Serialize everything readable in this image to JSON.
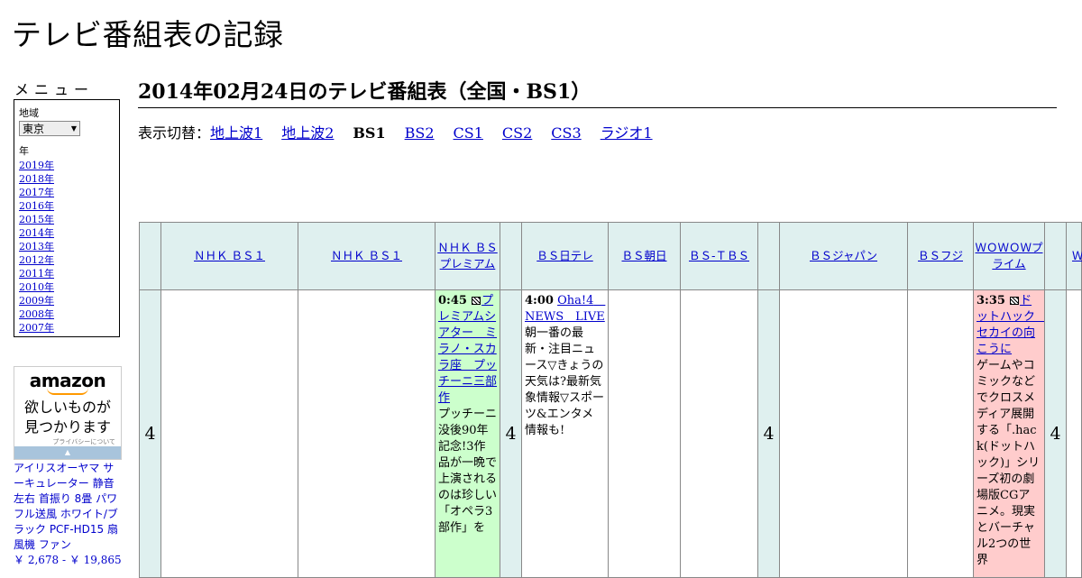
{
  "site": {
    "title": "テレビ番組表の記録"
  },
  "menu": {
    "heading": "メニュー",
    "region_label": "地域",
    "region_value": "東京",
    "year_label": "年",
    "years": [
      "2019年",
      "2018年",
      "2017年",
      "2016年",
      "2015年",
      "2014年",
      "2013年",
      "2012年",
      "2011年",
      "2010年",
      "2009年",
      "2008年",
      "2007年"
    ]
  },
  "ad": {
    "logo": "amazon",
    "tagline_1": "欲しいものが",
    "tagline_2": "見つかります",
    "privacy": "プライバシーについて",
    "bar_glyph": "▲",
    "product_title": "アイリスオーヤマ サーキュレーター 静音 左右 首振り 8畳 パワフル送風 ホワイト/ブラック PCF-HD15 扇風機 ファン",
    "product_price": "￥ 2,678 - ￥ 19,865"
  },
  "page": {
    "heading": "2014年02月24日のテレビ番組表（全国・BS1）",
    "switch_label": "表示切替：",
    "switch_items": [
      {
        "label": "地上波1",
        "current": false
      },
      {
        "label": "地上波2",
        "current": false
      },
      {
        "label": "BS1",
        "current": true
      },
      {
        "label": "BS2",
        "current": false
      },
      {
        "label": "CS1",
        "current": false
      },
      {
        "label": "CS2",
        "current": false
      },
      {
        "label": "CS3",
        "current": false
      },
      {
        "label": "ラジオ1",
        "current": false
      }
    ]
  },
  "grid": {
    "hour": "4",
    "channels": [
      "ＮＨＫ ＢＳ１",
      "ＮＨＫ ＢＳ１",
      "ＮＨＫ ＢＳプレミアム",
      "ＢＳ日テレ",
      "ＢＳ朝日",
      "ＢＳ-ＴＢＳ",
      "ＢＳジャパン",
      "ＢＳフジ",
      "ＷＯＷＯＷプライム",
      "Ｗ"
    ],
    "programs": {
      "premium": {
        "time": "0:45",
        "title": "プレミアムシアター　ミラノ・スカラ座　プッチーニ三部作",
        "desc": "プッチーニ没後90年記念!3作品が一晩で上演されるのは珍しい「オペラ3部作」を",
        "color": "#ccffcc"
      },
      "ntv": {
        "time": "4:00",
        "title": "Oha!4　NEWS　LIVE",
        "desc": "朝一番の最新・注目ニュース▽きょうの天気は?最新気象情報▽スポーツ&エンタメ情報も!"
      },
      "wowow": {
        "time": "3:35",
        "title": "ドットハック　セカイの向こうに",
        "desc": "ゲームやコミックなどでクロスメディア展開する「.hack(ドットハック)」シリーズ初の劇場版CGアニメ。現実とバーチャル2つの世界",
        "color": "#ffcccc"
      }
    }
  }
}
